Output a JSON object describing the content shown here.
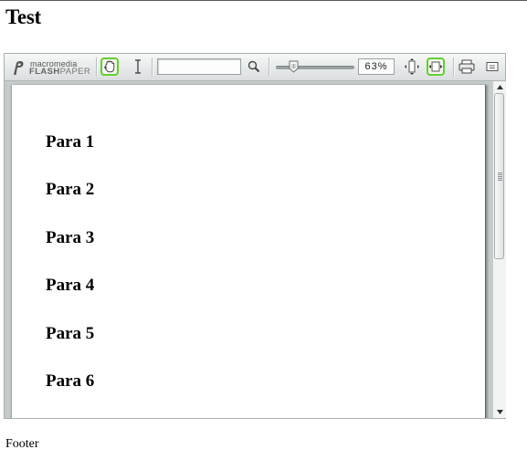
{
  "page": {
    "title": "Test",
    "footer": "Footer"
  },
  "viewer": {
    "brand": {
      "line1": "macromedia",
      "line2_bold": "FLASH",
      "line2_light": "PAPER"
    },
    "toolbar": {
      "search_value": "",
      "zoom_value": "63%",
      "zoom_slider_level": 0.18,
      "icons": [
        "hand-tool-icon",
        "text-select-icon",
        "search-icon",
        "zoom-slider",
        "fit-height-icon",
        "fit-width-icon",
        "print-icon",
        "menu-icon"
      ]
    },
    "document": {
      "paragraphs": [
        "Para 1",
        "Para 2",
        "Para 3",
        "Para 4",
        "Para 5",
        "Para 6"
      ]
    }
  },
  "colors": {
    "active_tool_border": "#66cc33",
    "viewer_background": "#c7cccb"
  }
}
